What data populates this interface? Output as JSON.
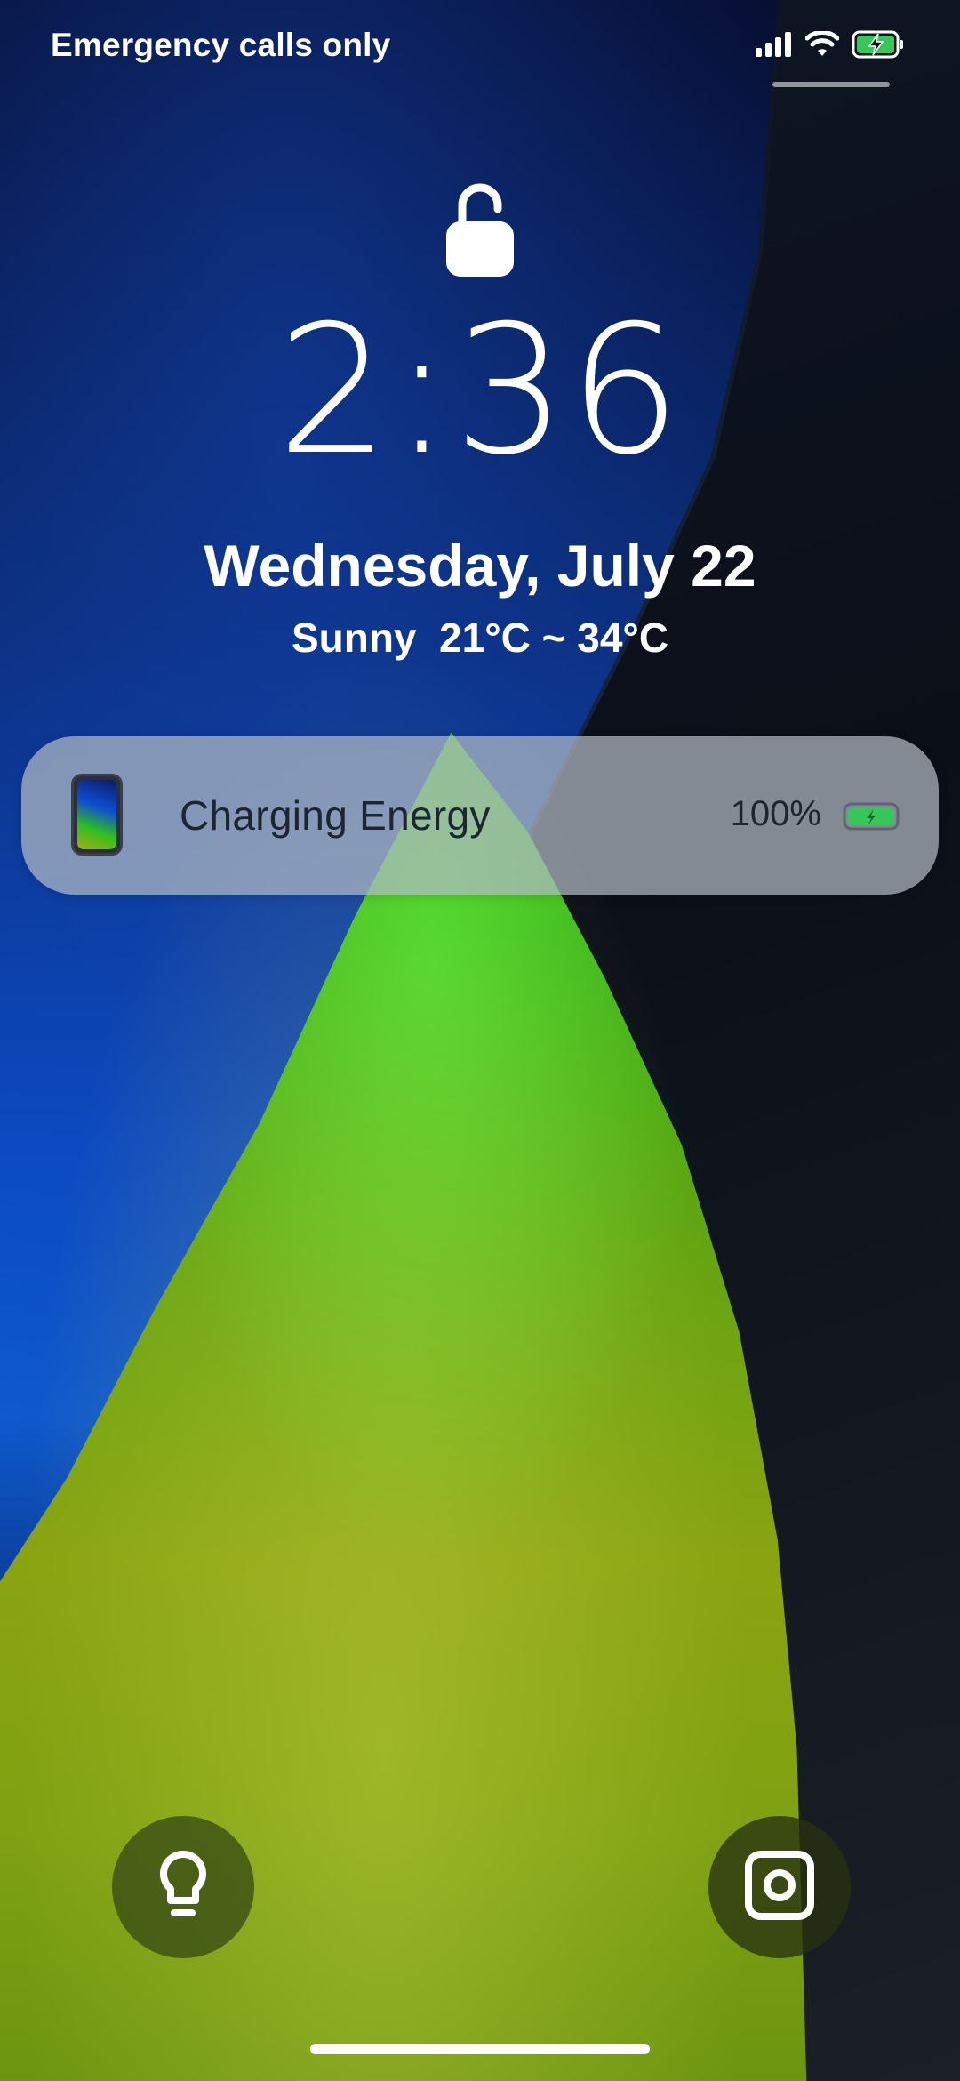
{
  "status_bar": {
    "carrier_text": "Emergency calls only",
    "icons": [
      "signal-icon",
      "wifi-icon",
      "battery-charging-icon"
    ]
  },
  "lock_screen": {
    "lock_icon": "unlocked-padlock-icon",
    "time": "2:36",
    "date": "Wednesday, July 22",
    "weather": "Sunny  21°C ~ 34°C"
  },
  "notification": {
    "app_icon": "phone-wallpaper-icon",
    "title": "Charging Energy",
    "battery_percent": "100%",
    "battery_level": 1.0,
    "battery_icon": "battery-charging-icon"
  },
  "shortcuts": {
    "left_icon": "flashlight-icon",
    "right_icon": "camera-icon"
  },
  "colors": {
    "battery_green": "#35c759",
    "notification_text": "#1d2530",
    "accent_blue": "#0d5bd0",
    "accent_green": "#2fb819"
  }
}
